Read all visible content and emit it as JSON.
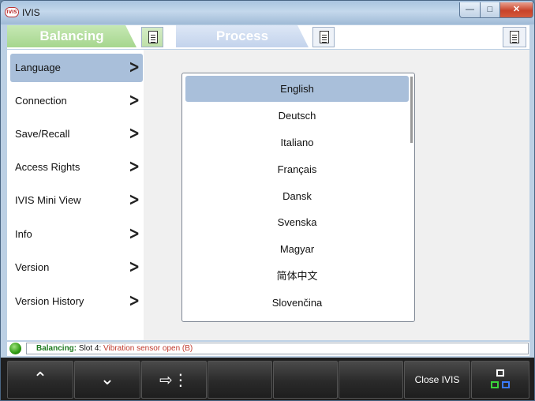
{
  "window": {
    "title": "IVIS",
    "icon_text": "IVIS"
  },
  "tabs": [
    {
      "label": "Balancing",
      "color": "#a6d68e"
    },
    {
      "label": "Process",
      "color": "#c3d3ec"
    }
  ],
  "sidebar": {
    "items": [
      {
        "label": "Language"
      },
      {
        "label": "Connection"
      },
      {
        "label": "Save/Recall"
      },
      {
        "label": "Access Rights"
      },
      {
        "label": "IVIS Mini View"
      },
      {
        "label": "Info"
      },
      {
        "label": "Version"
      },
      {
        "label": "Version History"
      }
    ],
    "selected_index": 0
  },
  "language_list": {
    "items": [
      "English",
      "Deutsch",
      "Italiano",
      "Français",
      "Dansk",
      "Svenska",
      "Magyar",
      "简体中文",
      "Slovenčina"
    ],
    "selected": "English"
  },
  "status": {
    "label": "Balancing:",
    "slot": "Slot 4:",
    "message": "Vibration sensor open (B)",
    "led_color": "#2e9a12",
    "message_color": "#c0392b"
  },
  "toolbar": {
    "buttons": [
      {
        "icon": "chevron-up-icon"
      },
      {
        "icon": "chevron-down-icon"
      },
      {
        "icon": "arrow-right-menu-icon"
      },
      {
        "icon": "empty"
      },
      {
        "icon": "empty"
      },
      {
        "icon": "empty"
      },
      {
        "label": "Close IVIS"
      },
      {
        "icon": "connection-boxes-icon"
      }
    ],
    "close_label": "Close IVIS"
  }
}
